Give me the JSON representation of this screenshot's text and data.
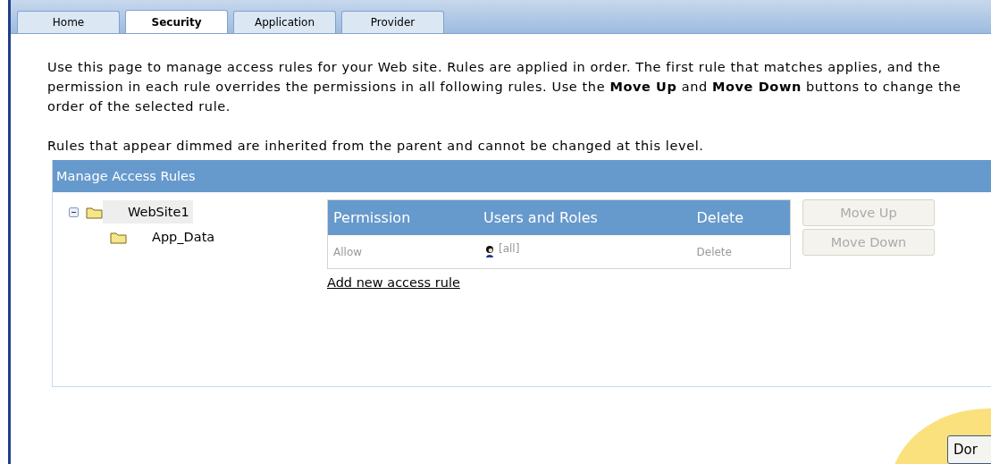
{
  "tabs": [
    {
      "label": "Home",
      "selected": false
    },
    {
      "label": "Security",
      "selected": true
    },
    {
      "label": "Application",
      "selected": false
    },
    {
      "label": "Provider",
      "selected": false
    }
  ],
  "intro": "Use this page to manage access rules for your Web site. Rules are applied in order. The first rule that matches applies, and the permission in each rule overrides the permissions in all following rules. Use the **Move Up** and **Move Down** buttons to change the order of the selected rule.",
  "note": "Rules that appear dimmed are inherited from the parent and cannot be changed at this level.",
  "panel": {
    "title": "Manage Access Rules",
    "tree": [
      {
        "label": "WebSite1",
        "expanded": true,
        "selected": true,
        "children": [
          {
            "label": "App_Data",
            "selected": false
          }
        ]
      }
    ],
    "table": {
      "columns": [
        "Permission",
        "Users and Roles",
        "Delete"
      ],
      "rows": [
        {
          "permission": "Allow",
          "users": "[all]",
          "delete": "Delete",
          "inherited": true
        }
      ]
    },
    "add_link": "Add new access rule",
    "buttons": [
      {
        "label": "Move Up",
        "disabled": true
      },
      {
        "label": "Move Down",
        "disabled": true
      }
    ]
  },
  "done_button": "Dor"
}
